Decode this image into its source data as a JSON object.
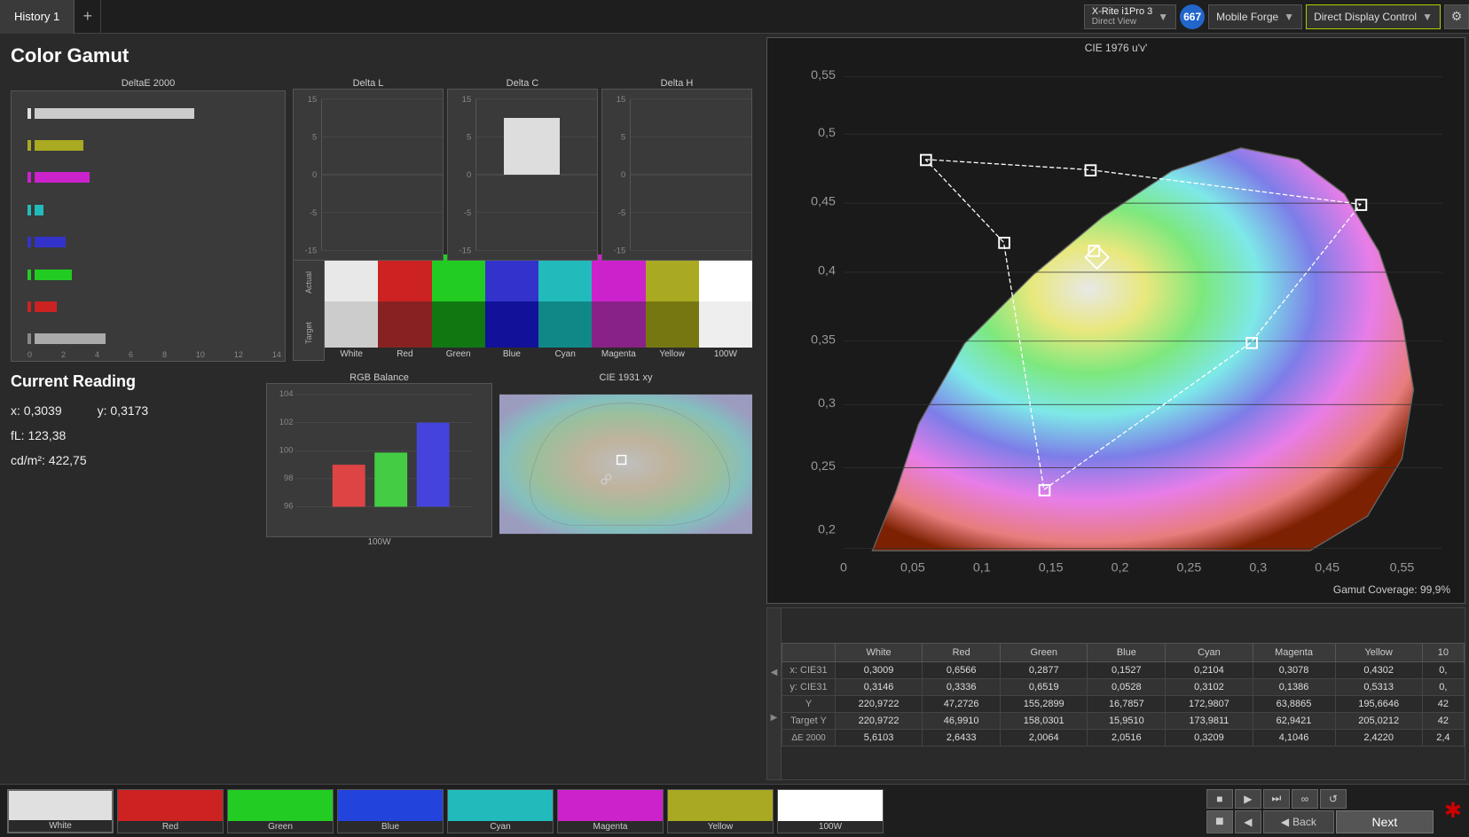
{
  "topbar": {
    "history_tab": "History 1",
    "add_tab": "+",
    "device": {
      "name": "X-Rite i1Pro 3",
      "sub": "Direct View",
      "badge": "667"
    },
    "forge": "Mobile Forge",
    "direct_display": "Direct Display Control",
    "gear": "⚙"
  },
  "main": {
    "title": "Color Gamut",
    "deltae_label": "DeltaE 2000",
    "charts": {
      "delta_l": "Delta L",
      "delta_c": "Delta C",
      "delta_h": "Delta H",
      "x_label": "100W"
    },
    "swatches": [
      {
        "label": "White",
        "actual": "#e8e8e8",
        "target": "#cccccc"
      },
      {
        "label": "Red",
        "actual": "#cc2222",
        "target": "#aa1111"
      },
      {
        "label": "Green",
        "actual": "#22cc22",
        "target": "#119911"
      },
      {
        "label": "Blue",
        "actual": "#3333cc",
        "target": "#1111aa"
      },
      {
        "label": "Cyan",
        "actual": "#22bbbb",
        "target": "#118888"
      },
      {
        "label": "Magenta",
        "actual": "#cc22cc",
        "target": "#aa11aa"
      },
      {
        "label": "Yellow",
        "actual": "#aaaa22",
        "target": "#888811"
      },
      {
        "label": "100W",
        "actual": "#ffffff",
        "target": "#eeeeee"
      }
    ]
  },
  "current_reading": {
    "title": "Current Reading",
    "x": "x: 0,3039",
    "y": "y: 0,3173",
    "fl": "fL: 123,38",
    "cd": "cd/m²: 422,75"
  },
  "rgb_balance": {
    "title": "RGB Balance",
    "x_label": "100W"
  },
  "cie1931": {
    "title": "CIE 1931 xy"
  },
  "cie1976": {
    "title": "CIE 1976 u'v'",
    "coverage": "Gamut Coverage:  99,9%"
  },
  "table": {
    "headers": [
      "",
      "White",
      "Red",
      "Green",
      "Blue",
      "Cyan",
      "Magenta",
      "Yellow",
      "10"
    ],
    "rows": [
      {
        "label": "x: CIE31",
        "values": [
          "0,3009",
          "0,6566",
          "0,2877",
          "0,1527",
          "0,2104",
          "0,3078",
          "0,4302",
          "0,"
        ]
      },
      {
        "label": "y: CIE31",
        "values": [
          "0,3146",
          "0,3336",
          "0,6519",
          "0,0528",
          "0,3102",
          "0,1386",
          "0,5313",
          "0,"
        ]
      },
      {
        "label": "Y",
        "values": [
          "220,9722",
          "47,2726",
          "155,2899",
          "16,7857",
          "172,9807",
          "63,8865",
          "195,6646",
          "42"
        ]
      },
      {
        "label": "Target Y",
        "values": [
          "220,9722",
          "46,9910",
          "158,0301",
          "15,9510",
          "173,9811",
          "62,9421",
          "205,0212",
          "42"
        ]
      },
      {
        "label": "ΔE 2000",
        "values": [
          "5,6103",
          "2,6433",
          "2,0064",
          "2,0516",
          "0,3209",
          "4,1046",
          "2,4220",
          "2,4"
        ]
      }
    ]
  },
  "bottom_colors": [
    {
      "label": "White",
      "color": "#e0e0e0"
    },
    {
      "label": "Red",
      "color": "#cc2222"
    },
    {
      "label": "Green",
      "color": "#22cc22"
    },
    {
      "label": "Blue",
      "color": "#2244dd"
    },
    {
      "label": "Cyan",
      "color": "#22bbbb"
    },
    {
      "label": "Magenta",
      "color": "#cc22cc"
    },
    {
      "label": "Yellow",
      "color": "#aaaa22"
    },
    {
      "label": "100W",
      "color": "#ffffff"
    }
  ],
  "nav": {
    "back": "Back",
    "next": "Next",
    "play": "▶",
    "pause": "■",
    "stop": "■",
    "skip": "⏭",
    "inf": "∞",
    "refresh": "↺",
    "prev_arrow": "◀",
    "next_arrow": "▶"
  }
}
